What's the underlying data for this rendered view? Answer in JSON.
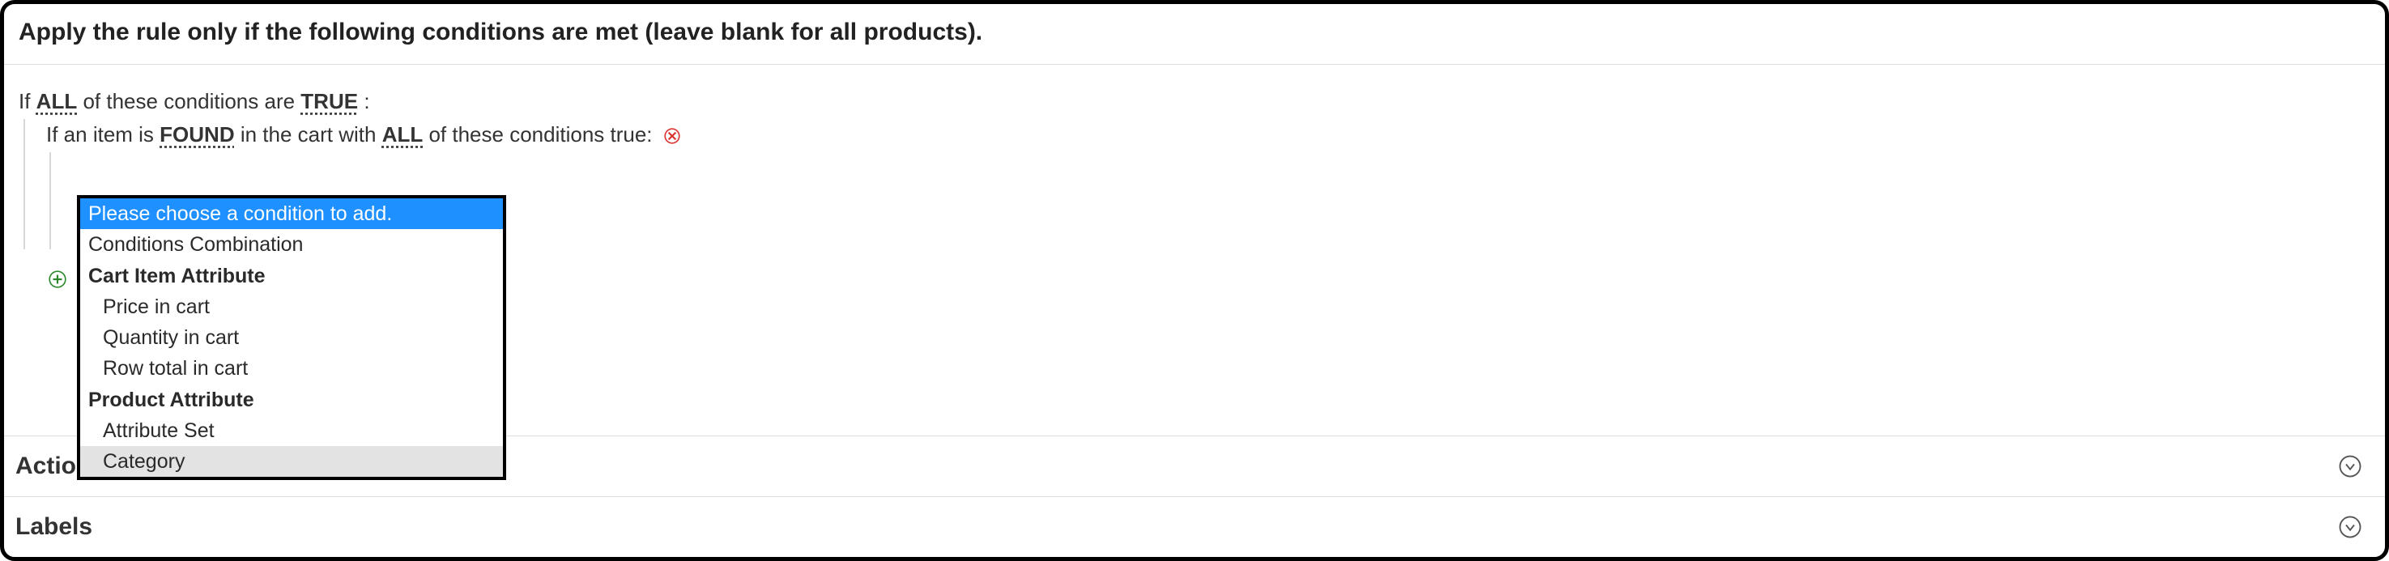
{
  "section_title": "Apply the rule only if the following conditions are met (leave blank for all products).",
  "root_condition": {
    "prefix": "If ",
    "aggregator": "ALL",
    "mid": " of these conditions are ",
    "value": "TRUE",
    "suffix": " :"
  },
  "child_condition": {
    "prefix": "If an item is ",
    "found": "FOUND",
    "mid": " in the cart with ",
    "aggregator": "ALL",
    "suffix": " of these conditions true:"
  },
  "dropdown": {
    "placeholder": "Please choose a condition to add.",
    "items": [
      {
        "label": "Conditions Combination",
        "type": "option"
      },
      {
        "label": "Cart Item Attribute",
        "type": "group"
      },
      {
        "label": "Price in cart",
        "type": "option",
        "child": true
      },
      {
        "label": "Quantity in cart",
        "type": "option",
        "child": true
      },
      {
        "label": "Row total in cart",
        "type": "option",
        "child": true
      },
      {
        "label": "Product Attribute",
        "type": "group"
      },
      {
        "label": "Attribute Set",
        "type": "option",
        "child": true
      },
      {
        "label": "Category",
        "type": "option",
        "child": true,
        "hovered": true
      }
    ]
  },
  "accordion": {
    "actions": "Actions",
    "labels": "Labels"
  },
  "icons": {
    "remove": "remove-icon",
    "add": "add-icon",
    "chevron": "chevron-down-icon"
  }
}
